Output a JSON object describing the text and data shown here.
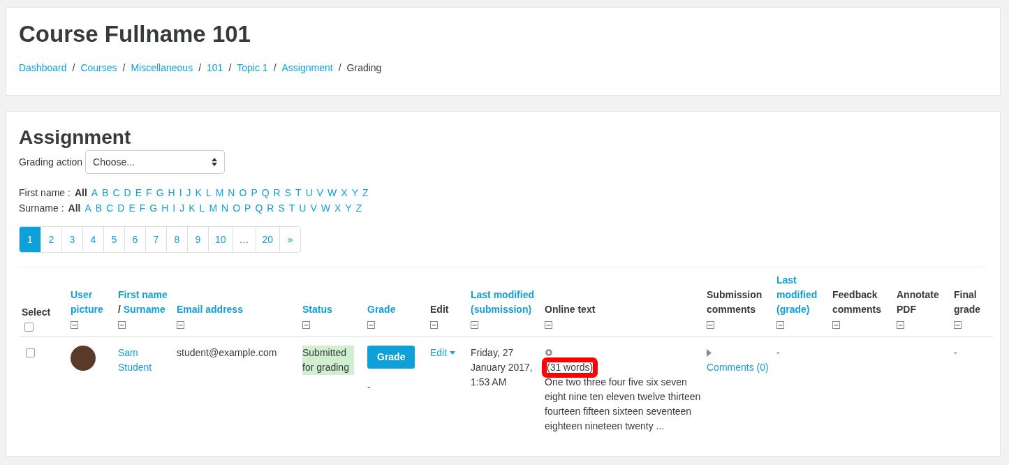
{
  "header": {
    "title": "Course Fullname 101",
    "breadcrumb": [
      {
        "kind": "link",
        "label": "Dashboard"
      },
      {
        "kind": "separator",
        "label": "/"
      },
      {
        "kind": "link",
        "label": "Courses"
      },
      {
        "kind": "separator",
        "label": "/"
      },
      {
        "kind": "link",
        "label": "Miscellaneous"
      },
      {
        "kind": "separator",
        "label": "/"
      },
      {
        "kind": "link",
        "label": "101"
      },
      {
        "kind": "separator",
        "label": "/"
      },
      {
        "kind": "link",
        "label": "Topic 1"
      },
      {
        "kind": "separator",
        "label": "/"
      },
      {
        "kind": "link",
        "label": "Assignment"
      },
      {
        "kind": "separator",
        "label": "/"
      },
      {
        "kind": "current",
        "label": "Grading"
      }
    ]
  },
  "main": {
    "title": "Assignment",
    "grading_action": {
      "label": "Grading action",
      "value": "Choose..."
    },
    "initials_filters": [
      {
        "label": "First name :",
        "all": "All",
        "letters": [
          "A",
          "B",
          "C",
          "D",
          "E",
          "F",
          "G",
          "H",
          "I",
          "J",
          "K",
          "L",
          "M",
          "N",
          "O",
          "P",
          "Q",
          "R",
          "S",
          "T",
          "U",
          "V",
          "W",
          "X",
          "Y",
          "Z"
        ]
      },
      {
        "label": "Surname :",
        "all": "All",
        "letters": [
          "A",
          "B",
          "C",
          "D",
          "E",
          "F",
          "G",
          "H",
          "I",
          "J",
          "K",
          "L",
          "M",
          "N",
          "O",
          "P",
          "Q",
          "R",
          "S",
          "T",
          "U",
          "V",
          "W",
          "X",
          "Y",
          "Z"
        ]
      }
    ],
    "pagination": [
      {
        "label": "1",
        "selected": true
      },
      {
        "label": "2",
        "selected": false
      },
      {
        "label": "3",
        "selected": false
      },
      {
        "label": "4",
        "selected": false
      },
      {
        "label": "5",
        "selected": false
      },
      {
        "label": "6",
        "selected": false
      },
      {
        "label": "7",
        "selected": false
      },
      {
        "label": "8",
        "selected": false
      },
      {
        "label": "9",
        "selected": false
      },
      {
        "label": "10",
        "selected": false
      },
      {
        "label": "…",
        "selected": false
      },
      {
        "label": "20",
        "selected": false
      },
      {
        "label": "»",
        "selected": false
      }
    ],
    "table": {
      "columns": [
        {
          "kind": "select",
          "label": "Select",
          "checked": false
        },
        {
          "kind": "link",
          "label": "User picture"
        },
        {
          "kind": "pair",
          "parts": [
            "First name",
            "/",
            "Surname"
          ]
        },
        {
          "kind": "link",
          "label": "Email address"
        },
        {
          "kind": "link",
          "label": "Status"
        },
        {
          "kind": "link",
          "label": "Grade"
        },
        {
          "kind": "plain",
          "label": "Edit"
        },
        {
          "kind": "link",
          "label": "Last modified (submission)"
        },
        {
          "kind": "plain",
          "label": "Online text"
        },
        {
          "kind": "plain",
          "label": "Submission comments"
        },
        {
          "kind": "link",
          "label": "Last modified (grade)"
        },
        {
          "kind": "plain",
          "label": "Feedback comments"
        },
        {
          "kind": "plain",
          "label": "Annotate PDF"
        },
        {
          "kind": "plain",
          "label": "Final grade"
        }
      ],
      "rows": [
        {
          "checked": false,
          "name": "Sam Student",
          "email": "student@example.com",
          "status": "Submitted for grading",
          "grade_button": "Grade",
          "grade": "-",
          "edit": "Edit",
          "last_modified": "Friday, 27 January 2017, 1:53 AM",
          "online_text": {
            "word_count": "(31 words)",
            "highlighted": true,
            "excerpt": "One two three four five six seven eight nine ten eleven twelve thirteen fourteen fifteen sixteen seventeen eighteen nineteen twenty ..."
          },
          "comments": {
            "expanded": false,
            "link": "Comments (0)"
          },
          "last_modified_grade": "-",
          "final_grade": "-"
        }
      ]
    }
  }
}
